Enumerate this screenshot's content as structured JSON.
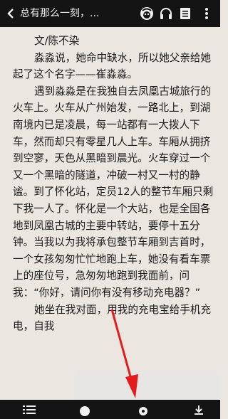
{
  "topbar": {
    "title": "总有那么一刻，...",
    "icons": [
      "back-icon",
      "face-icon",
      "headphones-icon",
      "menu-list-icon",
      "more-vertical-icon"
    ]
  },
  "content": {
    "byline": "文/陈不染",
    "paragraphs": [
      "淼淼说，她命中缺水，所以她父亲给她起了这个名字——崔淼淼。",
      "遇到淼淼是在我独自去凤凰古城旅行的火车上。火车从广州始发，一路北上，到湖南境内已是凌晨，每一站都有一大拨人下车，然而却只有零星几人上车。车厢从拥挤到空寥，天色从黑暗到晨光。火车穿过一个又一个黑暗的隧道，冲破一村又一村的静谧。到了怀化站，定员12人的整节车厢只剩下我一人了。怀化是一个大站，也是全国各地到凤凰古城的主要中转站，要停十五分钟。当我以为我将承包整节车厢到吉首时，一个女孩匆匆忙忙地跑上车，她没有看车票上的座位号，急匆匆地跑到我面前，问我：“你好，请问你有没有移动充电器？”",
      "她坐在我对面，用我的充电宝给手机充电，自我"
    ]
  },
  "bottombar": {
    "icons": [
      "list-icon",
      "brightness-icon",
      "settings-gear-icon",
      "download-icon"
    ]
  },
  "annotation": {
    "color": "#e11d1d"
  }
}
